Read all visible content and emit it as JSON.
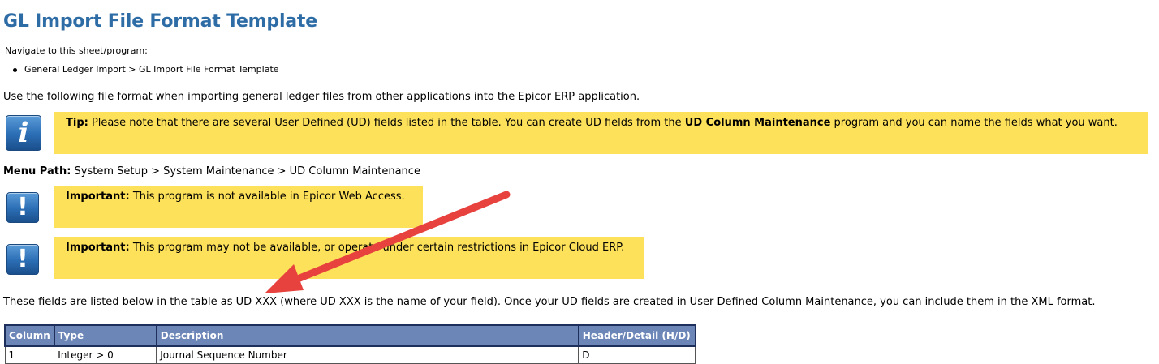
{
  "page_title": "GL Import File Format Template",
  "navigate_label": "Navigate to this sheet/program:",
  "navigate_item": "General Ledger Import > GL Import File Format Template",
  "intro_text": "Use the following file format when importing general ledger files from other applications into the Epicor ERP application.",
  "tip": {
    "label": "Tip:",
    "text_before": " Please note that there are several User Defined (UD) fields listed in the table. You can create UD fields from the ",
    "program": "UD Column Maintenance",
    "text_after": " program and you can name the fields what you want."
  },
  "menu_path": {
    "label": "Menu Path:",
    "value": " System Setup > System Maintenance > UD Column Maintenance"
  },
  "important_1": {
    "label": "Important:",
    "text": " This program is not available in Epicor Web Access."
  },
  "important_2": {
    "label": "Important:",
    "text": " This program may not be available, or operate under certain restrictions in Epicor Cloud ERP."
  },
  "fields_text": "These fields are listed below in the table as UD XXX (where UD XXX is the name of your field). Once your UD fields are created in User Defined Column Maintenance, you can include them in the XML format.",
  "table": {
    "headers": [
      "Column",
      "Type",
      "Description",
      "Header/Detail (H/D)"
    ],
    "rows": [
      [
        "1",
        "Integer > 0",
        "Journal Sequence Number",
        "D"
      ]
    ]
  },
  "icons": {
    "tip": "info-icon",
    "important": "exclamation-icon"
  },
  "colors": {
    "title": "#2e6ca6",
    "note_bg": "#fee15a",
    "table_header": "#6d86b8",
    "arrow": "#e8423f"
  }
}
